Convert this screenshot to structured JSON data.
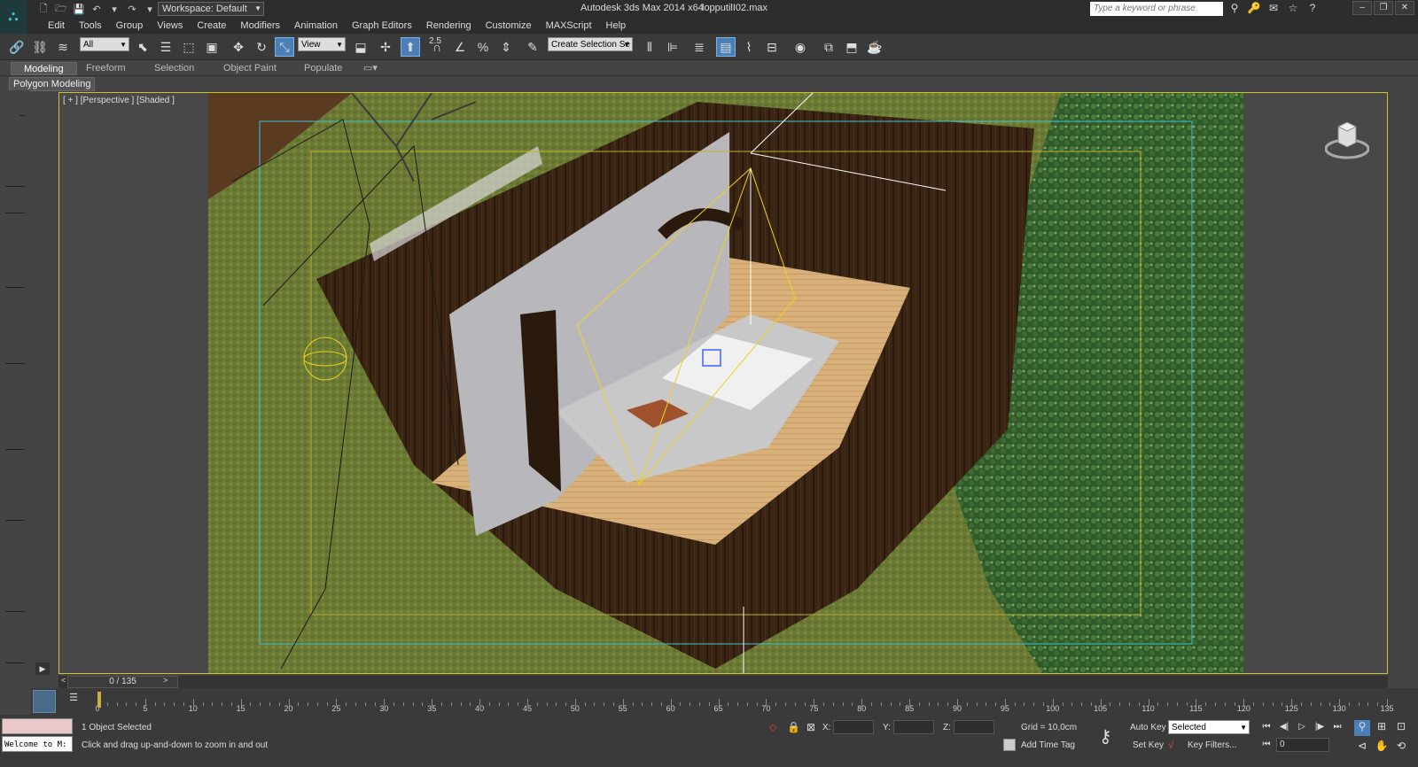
{
  "app": {
    "title": "Autodesk 3ds Max  2014 x64",
    "file": "lopputilI02.max",
    "logo_icon": "3ds-max-logo-icon"
  },
  "workspace": {
    "label": "Workspace: Default"
  },
  "search": {
    "placeholder": "Type a keyword or phrase"
  },
  "menu": [
    "Edit",
    "Tools",
    "Group",
    "Views",
    "Create",
    "Modifiers",
    "Animation",
    "Graph Editors",
    "Rendering",
    "Customize",
    "MAXScript",
    "Help"
  ],
  "toolbar": {
    "filter_select": "All",
    "ref_coord": "View",
    "snap_value": "2.5",
    "named_selection": "Create Selection Se"
  },
  "ribbon": {
    "tabs": [
      "Modeling",
      "Freeform",
      "Selection",
      "Object Paint",
      "Populate"
    ],
    "active_tab": "Modeling",
    "panel": "Polygon Modeling"
  },
  "viewport": {
    "label": "[ + ] [Perspective ] [Shaded ]"
  },
  "timeline": {
    "frame_display": "0 / 135",
    "ticks": [
      0,
      5,
      10,
      15,
      20,
      25,
      30,
      35,
      40,
      45,
      50,
      55,
      60,
      65,
      70,
      75,
      80,
      85,
      90,
      95,
      100,
      105,
      110,
      115,
      120,
      125,
      130,
      135
    ],
    "max_frame": 135
  },
  "status": {
    "selection": "1 Object Selected",
    "prompt": "Click and drag up-and-down to zoom in and out",
    "maxscript": "Welcome to M:",
    "x_label": "X:",
    "y_label": "Y:",
    "z_label": "Z:",
    "grid": "Grid = 10,0cm",
    "add_time_tag": "Add Time Tag",
    "auto_key": "Auto Key",
    "set_key": "Set Key",
    "key_mode": "Selected",
    "key_filters": "Key Filters...",
    "current_frame": "0"
  }
}
